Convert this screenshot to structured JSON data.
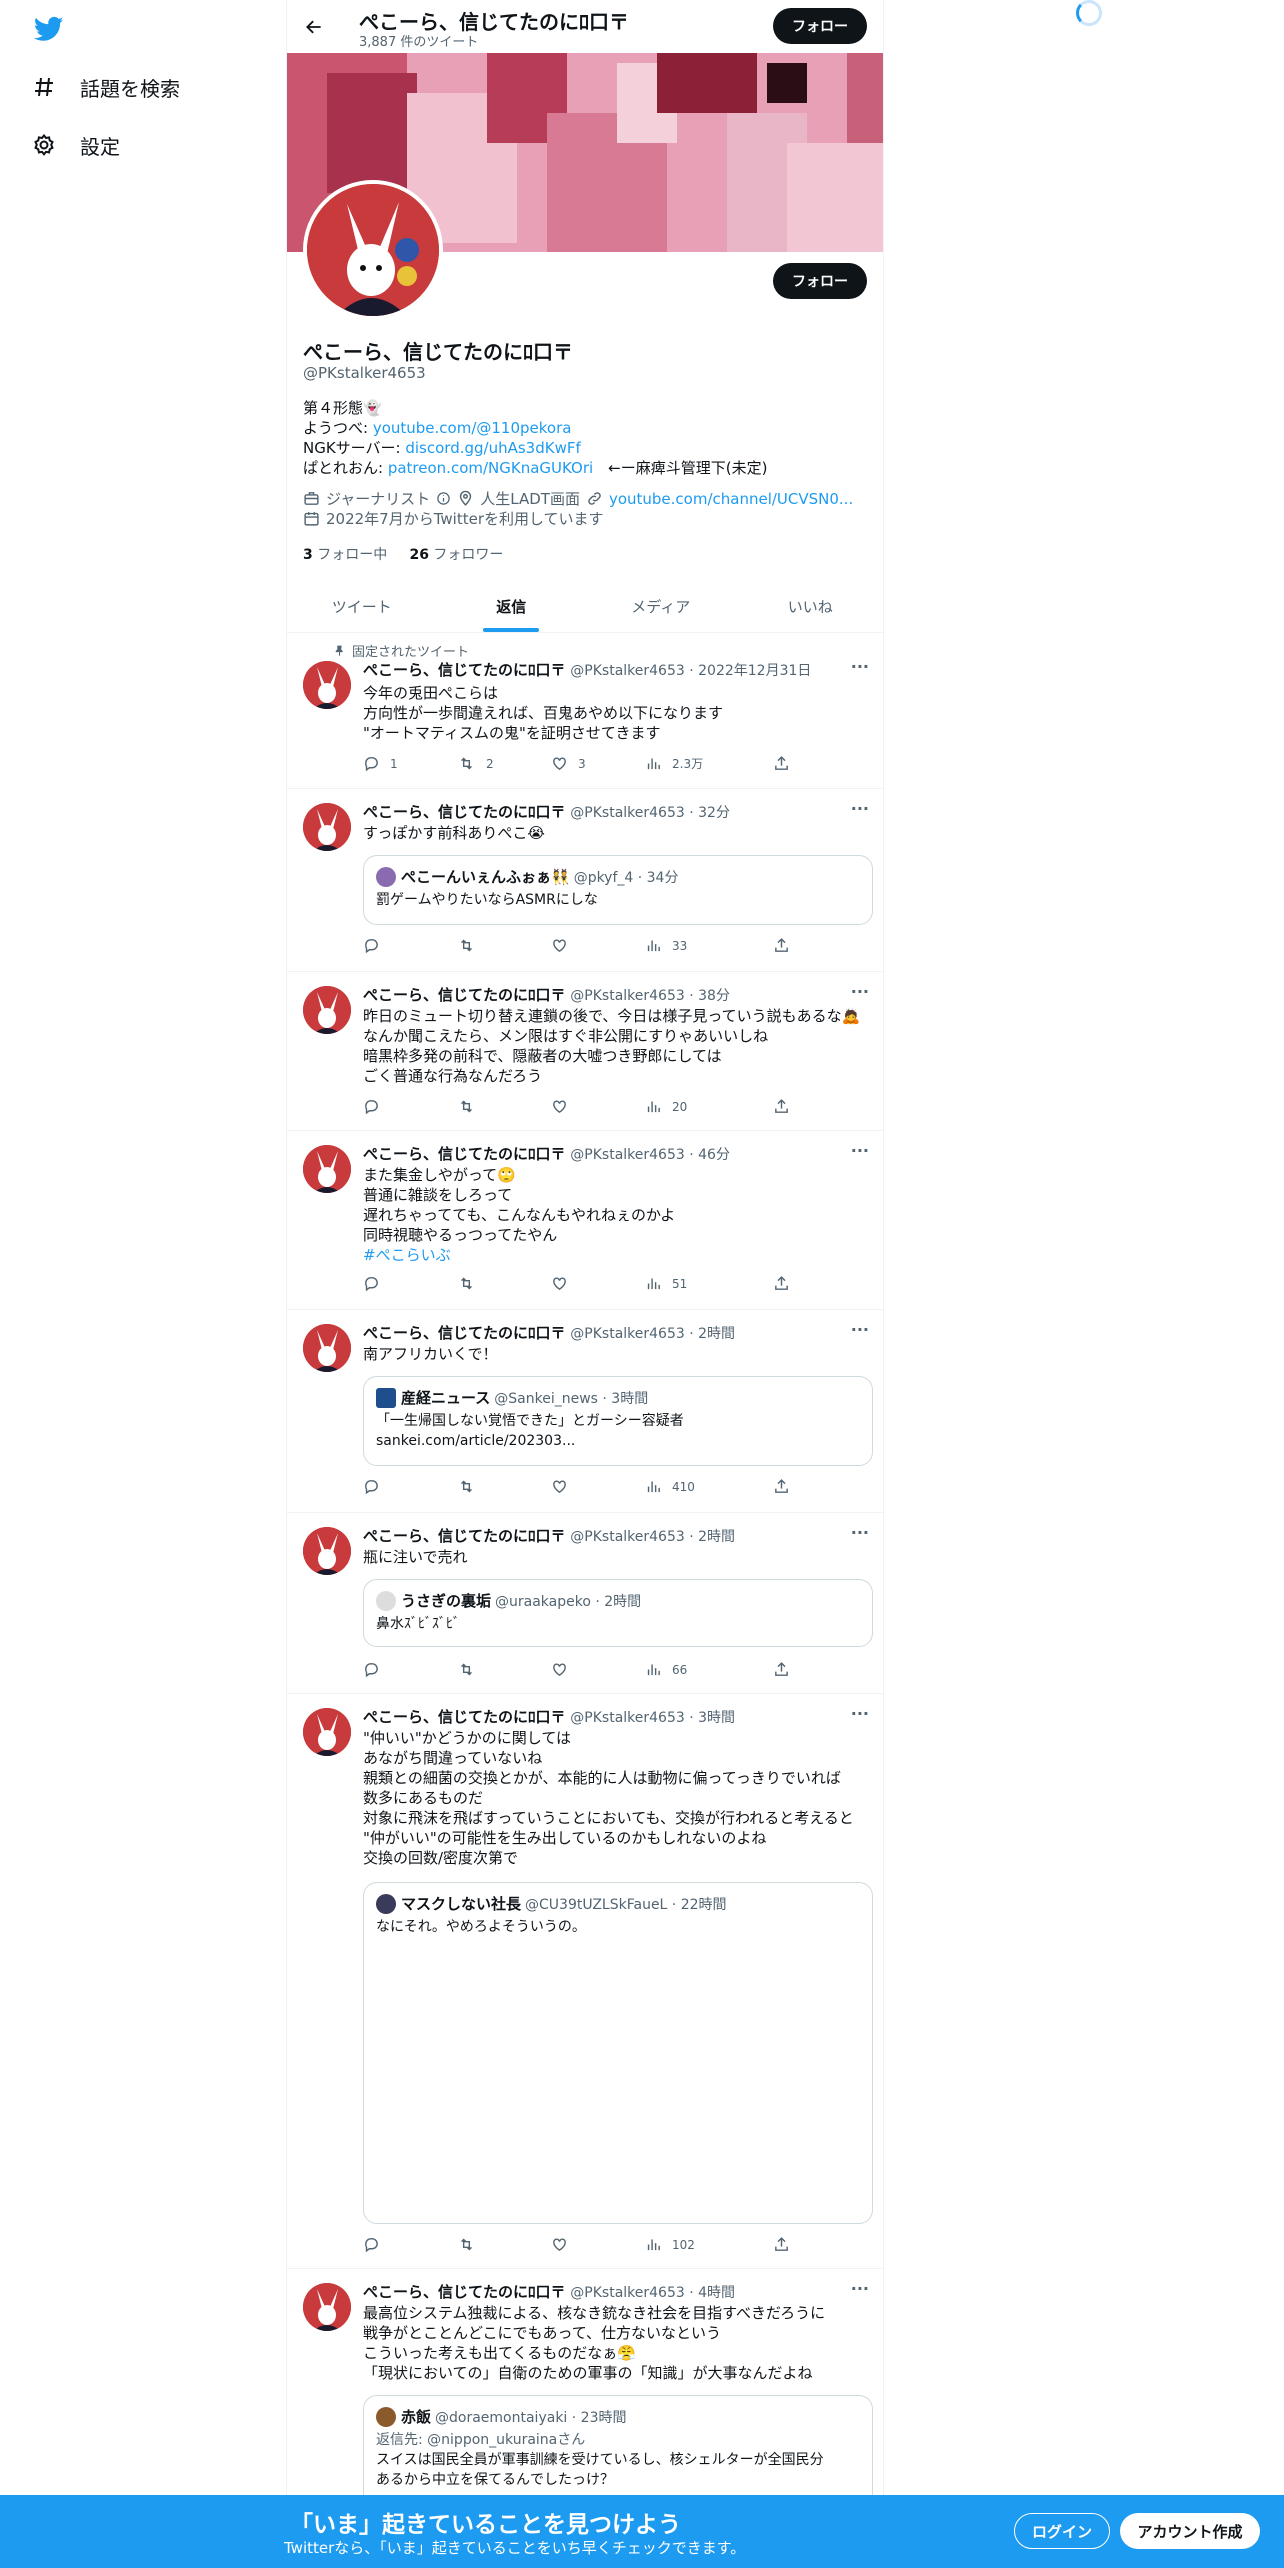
{
  "sidebar": {
    "items": [
      {
        "label": "話題を検索",
        "icon": "hash-icon"
      },
      {
        "label": "設定",
        "icon": "gear-icon"
      }
    ]
  },
  "header": {
    "name": "ぺこーら、信じてたのにﾛ口〒",
    "tweet_count": "3,887 件のツイート",
    "follow": "フォロー"
  },
  "profile": {
    "name": "ぺこーら、信じてたのにﾛ口〒",
    "handle": "@PKstalker4653",
    "follow": "フォロー",
    "bio": [
      {
        "text": "第４形態👻",
        "link": ""
      },
      {
        "text": "ようつべ: ",
        "link": "youtube.com/@110pekora"
      },
      {
        "text": "NGKサーバー: ",
        "link": "discord.gg/uhAs3dKwFf"
      },
      {
        "text": "ぱとれおん: ",
        "link": "patreon.com/NGKnaGUKOri",
        "suffix": "　←ー麻痺斗管理下(未定)"
      }
    ],
    "job": "ジャーナリスト",
    "location": "人生LADT画面",
    "url": "youtube.com/channel/UCVSN0...",
    "joined": "2022年7月からTwitterを利用しています",
    "following_count": "3",
    "following_label": "フォロー中",
    "followers_count": "26",
    "followers_label": "フォロワー"
  },
  "tabs": [
    "ツイート",
    "返信",
    "メディア",
    "いいね"
  ],
  "pinned_label": "固定されたツイート",
  "tweets": [
    {
      "name": "ぺこーら、信じてたのにﾛ口〒",
      "meta": "@PKstalker4653 · 2022年12月31日",
      "lines": [
        "今年の兎田ぺこらは",
        "方向性が一歩間違えれば、百鬼あやめ以下になります",
        "\"オートマティスムの鬼\"を証明させてきます"
      ],
      "reply": "1",
      "retweet": "2",
      "like": "3",
      "views": "2.3万"
    },
    {
      "name": "ぺこーら、信じてたのにﾛ口〒",
      "meta": "@PKstalker4653 · 32分",
      "lines": [
        "すっぽかす前科ありぺこ😭"
      ],
      "quote": {
        "name": "ぺこーんいぇんふぉぁ👯",
        "meta": "@pkyf_4 · 34分",
        "lines": [
          "罰ゲームやりたいならASMRにしな"
        ]
      },
      "reply": "",
      "retweet": "",
      "like": "",
      "views": "33"
    },
    {
      "name": "ぺこーら、信じてたのにﾛ口〒",
      "meta": "@PKstalker4653 · 38分",
      "lines": [
        "昨日のミュート切り替え連鎖の後で、今日は様子見っていう説もあるな🙇",
        "なんか聞こえたら、メン限はすぐ非公開にすりゃあいいしね",
        "暗黒枠多発の前科で、隠蔽者の大嘘つき野郎にしては",
        "ごく普通な行為なんだろう"
      ],
      "reply": "",
      "retweet": "",
      "like": "",
      "views": "20"
    },
    {
      "name": "ぺこーら、信じてたのにﾛ口〒",
      "meta": "@PKstalker4653 · 46分",
      "lines": [
        "また集金しやがって🙄",
        "普通に雑談をしろって",
        "遅れちゃってても、こんなんもやれねぇのかよ",
        "同時視聴やるっつってたやん"
      ],
      "hashtag": "#ぺこらいぶ",
      "reply": "",
      "retweet": "",
      "like": "",
      "views": "51"
    },
    {
      "name": "ぺこーら、信じてたのにﾛ口〒",
      "meta": "@PKstalker4653 · 2時間",
      "lines": [
        "南アフリカいくで！"
      ],
      "quote": {
        "name": "産経ニュース",
        "meta": "@Sankei_news · 3時間",
        "lines": [
          "「一生帰国しない覚悟できた」とガーシー容疑者",
          "sankei.com/article/202303..."
        ]
      },
      "reply": "",
      "retweet": "",
      "like": "",
      "views": "410"
    },
    {
      "name": "ぺこーら、信じてたのにﾛ口〒",
      "meta": "@PKstalker4653 · 2時間",
      "lines": [
        "瓶に注いで売れ"
      ],
      "quote": {
        "name": "うさぎの裏垢",
        "meta": "@uraakapeko · 2時間",
        "lines": [
          "鼻水ｽﾞﾋﾞｽﾞﾋﾞ"
        ]
      },
      "reply": "",
      "retweet": "",
      "like": "",
      "views": "66"
    },
    {
      "name": "ぺこーら、信じてたのにﾛ口〒",
      "meta": "@PKstalker4653 · 3時間",
      "lines": [
        "\"仲いい\"かどうかのに関しては",
        "あながち間違っていないね",
        "親類との細菌の交換とかが、本能的に人は動物に偏ってっきりでいれば",
        "数多にあるものだ",
        "対象に飛沫を飛ばすっていうことにおいても、交換が行われると考えると",
        "\"仲がいい\"の可能性を生み出しているのかもしれないのよね",
        "交換の回数/密度次第で"
      ],
      "quote": {
        "name": "マスクしない社長",
        "meta": "@CU39tUZLSkFaueL · 22時間",
        "lines": [
          "なにそれ。やめろよそういうの。"
        ]
      },
      "reply": "",
      "retweet": "",
      "like": "",
      "views": "102"
    },
    {
      "name": "ぺこーら、信じてたのにﾛ口〒",
      "meta": "@PKstalker4653 · 4時間",
      "lines": [
        "最高位システム独裁による、核なき銃なき社会を目指すべきだろうに",
        "戦争がとことんどこにでもあって、仕方ないなという",
        "こういった考えも出てくるものだなぁ😤",
        "「現状においての」自衛のための軍事の「知識」が大事なんだよね"
      ],
      "quote": {
        "name": "赤飯",
        "meta": "@doraemontaiyaki · 23時間",
        "reply_to": "返信先: @nippon_ukurainaさん",
        "lines": [
          "スイスは国民全員が軍事訓練を受けているし、核シェルターが全国民分",
          "あるから中立を保てるんでしたっけ？"
        ]
      },
      "reply": "",
      "retweet": "",
      "like": "",
      "views": ""
    }
  ],
  "bottombar": {
    "title": "「いま」起きていることを見つけよう",
    "subtitle": "Twitterなら、「いま」起きていることをいち早くチェックできます。",
    "login": "ログイン",
    "signup": "アカウント作成"
  }
}
